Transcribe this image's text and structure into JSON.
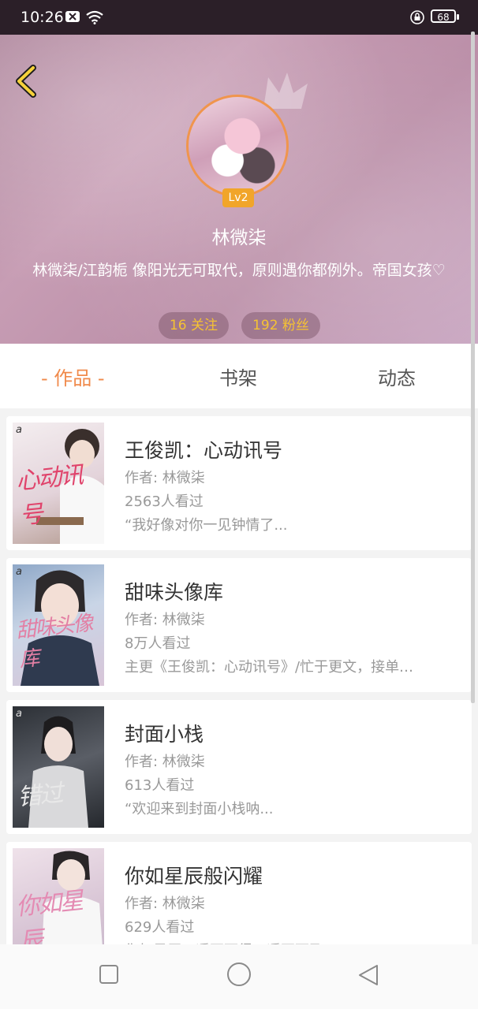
{
  "status": {
    "time": "10:26",
    "battery": "68"
  },
  "profile": {
    "level": "Lv2",
    "name": "林微柒",
    "bio": "林微柒/江韵栀 像阳光无可取代，原则遇你都例外。帝国女孩♡",
    "follow": "16 关注",
    "fans": "192 粉丝"
  },
  "tabs": [
    "- 作品 -",
    "书架",
    "动态"
  ],
  "works": [
    {
      "title": "王俊凯：心动讯号",
      "author": "作者: 林微柒",
      "views": "2563人看过",
      "desc": "“我好像对你一见钟情了...",
      "cover_text": "心动讯号",
      "cover_colors": [
        "#f4eef0",
        "#d9c8cf"
      ]
    },
    {
      "title": "甜味头像库",
      "author": "作者: 林微柒",
      "views": "8万人看过",
      "desc": "主更《王俊凯：心动讯号》/忙于更文，接单…",
      "cover_text": "甜味头像库",
      "cover_colors": [
        "#9db3d0",
        "#d8c5d8"
      ]
    },
    {
      "title": "封面小栈",
      "author": "作者: 林微柒",
      "views": "613人看过",
      "desc": "“欢迎来到封面小栈呐...",
      "cover_text": "错过",
      "cover_colors": [
        "#3b3f45",
        "#8a8d92"
      ]
    },
    {
      "title": "你如星辰般闪耀",
      "author": "作者: 林微柒",
      "views": "629人看过",
      "desc": "你如星辰，遥不可得，遥不可及",
      "cover_text": "你如星辰",
      "cover_colors": [
        "#e9d6e0",
        "#c9b8cf"
      ]
    }
  ]
}
